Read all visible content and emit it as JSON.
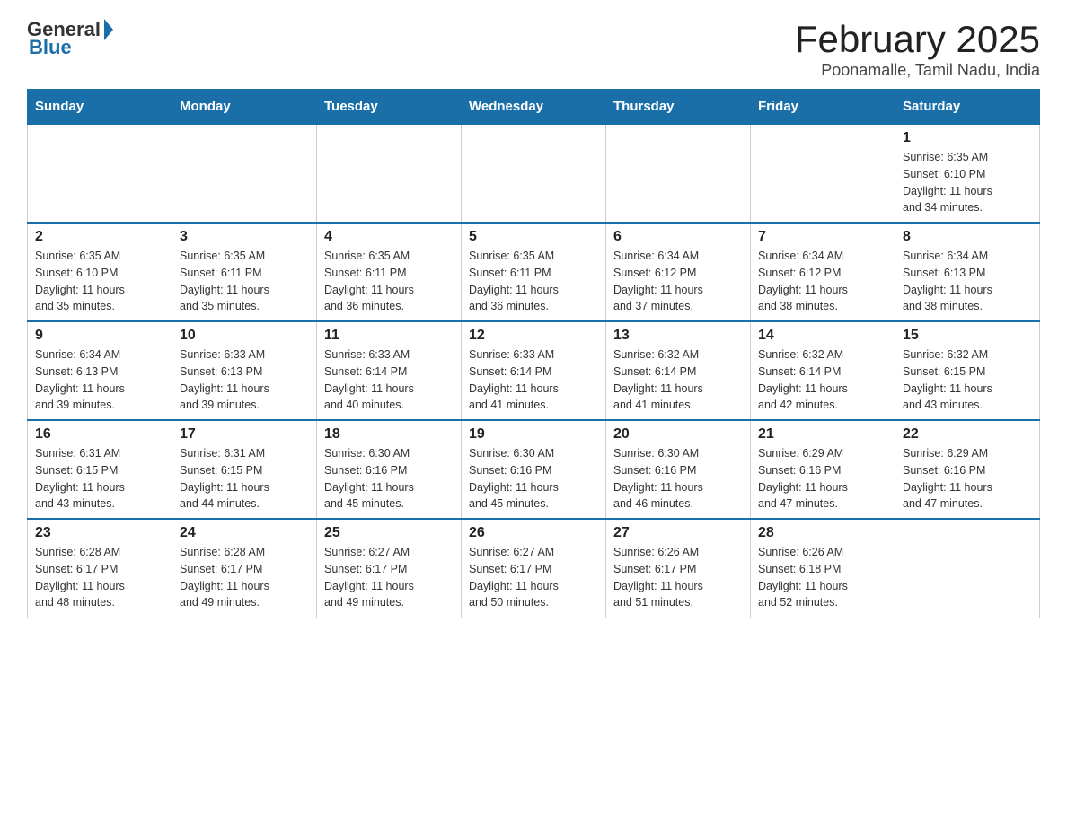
{
  "header": {
    "logo_general": "General",
    "logo_blue": "Blue",
    "title": "February 2025",
    "subtitle": "Poonamalle, Tamil Nadu, India"
  },
  "days_of_week": [
    "Sunday",
    "Monday",
    "Tuesday",
    "Wednesday",
    "Thursday",
    "Friday",
    "Saturday"
  ],
  "weeks": [
    [
      {
        "day": "",
        "info": ""
      },
      {
        "day": "",
        "info": ""
      },
      {
        "day": "",
        "info": ""
      },
      {
        "day": "",
        "info": ""
      },
      {
        "day": "",
        "info": ""
      },
      {
        "day": "",
        "info": ""
      },
      {
        "day": "1",
        "info": "Sunrise: 6:35 AM\nSunset: 6:10 PM\nDaylight: 11 hours\nand 34 minutes."
      }
    ],
    [
      {
        "day": "2",
        "info": "Sunrise: 6:35 AM\nSunset: 6:10 PM\nDaylight: 11 hours\nand 35 minutes."
      },
      {
        "day": "3",
        "info": "Sunrise: 6:35 AM\nSunset: 6:11 PM\nDaylight: 11 hours\nand 35 minutes."
      },
      {
        "day": "4",
        "info": "Sunrise: 6:35 AM\nSunset: 6:11 PM\nDaylight: 11 hours\nand 36 minutes."
      },
      {
        "day": "5",
        "info": "Sunrise: 6:35 AM\nSunset: 6:11 PM\nDaylight: 11 hours\nand 36 minutes."
      },
      {
        "day": "6",
        "info": "Sunrise: 6:34 AM\nSunset: 6:12 PM\nDaylight: 11 hours\nand 37 minutes."
      },
      {
        "day": "7",
        "info": "Sunrise: 6:34 AM\nSunset: 6:12 PM\nDaylight: 11 hours\nand 38 minutes."
      },
      {
        "day": "8",
        "info": "Sunrise: 6:34 AM\nSunset: 6:13 PM\nDaylight: 11 hours\nand 38 minutes."
      }
    ],
    [
      {
        "day": "9",
        "info": "Sunrise: 6:34 AM\nSunset: 6:13 PM\nDaylight: 11 hours\nand 39 minutes."
      },
      {
        "day": "10",
        "info": "Sunrise: 6:33 AM\nSunset: 6:13 PM\nDaylight: 11 hours\nand 39 minutes."
      },
      {
        "day": "11",
        "info": "Sunrise: 6:33 AM\nSunset: 6:14 PM\nDaylight: 11 hours\nand 40 minutes."
      },
      {
        "day": "12",
        "info": "Sunrise: 6:33 AM\nSunset: 6:14 PM\nDaylight: 11 hours\nand 41 minutes."
      },
      {
        "day": "13",
        "info": "Sunrise: 6:32 AM\nSunset: 6:14 PM\nDaylight: 11 hours\nand 41 minutes."
      },
      {
        "day": "14",
        "info": "Sunrise: 6:32 AM\nSunset: 6:14 PM\nDaylight: 11 hours\nand 42 minutes."
      },
      {
        "day": "15",
        "info": "Sunrise: 6:32 AM\nSunset: 6:15 PM\nDaylight: 11 hours\nand 43 minutes."
      }
    ],
    [
      {
        "day": "16",
        "info": "Sunrise: 6:31 AM\nSunset: 6:15 PM\nDaylight: 11 hours\nand 43 minutes."
      },
      {
        "day": "17",
        "info": "Sunrise: 6:31 AM\nSunset: 6:15 PM\nDaylight: 11 hours\nand 44 minutes."
      },
      {
        "day": "18",
        "info": "Sunrise: 6:30 AM\nSunset: 6:16 PM\nDaylight: 11 hours\nand 45 minutes."
      },
      {
        "day": "19",
        "info": "Sunrise: 6:30 AM\nSunset: 6:16 PM\nDaylight: 11 hours\nand 45 minutes."
      },
      {
        "day": "20",
        "info": "Sunrise: 6:30 AM\nSunset: 6:16 PM\nDaylight: 11 hours\nand 46 minutes."
      },
      {
        "day": "21",
        "info": "Sunrise: 6:29 AM\nSunset: 6:16 PM\nDaylight: 11 hours\nand 47 minutes."
      },
      {
        "day": "22",
        "info": "Sunrise: 6:29 AM\nSunset: 6:16 PM\nDaylight: 11 hours\nand 47 minutes."
      }
    ],
    [
      {
        "day": "23",
        "info": "Sunrise: 6:28 AM\nSunset: 6:17 PM\nDaylight: 11 hours\nand 48 minutes."
      },
      {
        "day": "24",
        "info": "Sunrise: 6:28 AM\nSunset: 6:17 PM\nDaylight: 11 hours\nand 49 minutes."
      },
      {
        "day": "25",
        "info": "Sunrise: 6:27 AM\nSunset: 6:17 PM\nDaylight: 11 hours\nand 49 minutes."
      },
      {
        "day": "26",
        "info": "Sunrise: 6:27 AM\nSunset: 6:17 PM\nDaylight: 11 hours\nand 50 minutes."
      },
      {
        "day": "27",
        "info": "Sunrise: 6:26 AM\nSunset: 6:17 PM\nDaylight: 11 hours\nand 51 minutes."
      },
      {
        "day": "28",
        "info": "Sunrise: 6:26 AM\nSunset: 6:18 PM\nDaylight: 11 hours\nand 52 minutes."
      },
      {
        "day": "",
        "info": ""
      }
    ]
  ]
}
